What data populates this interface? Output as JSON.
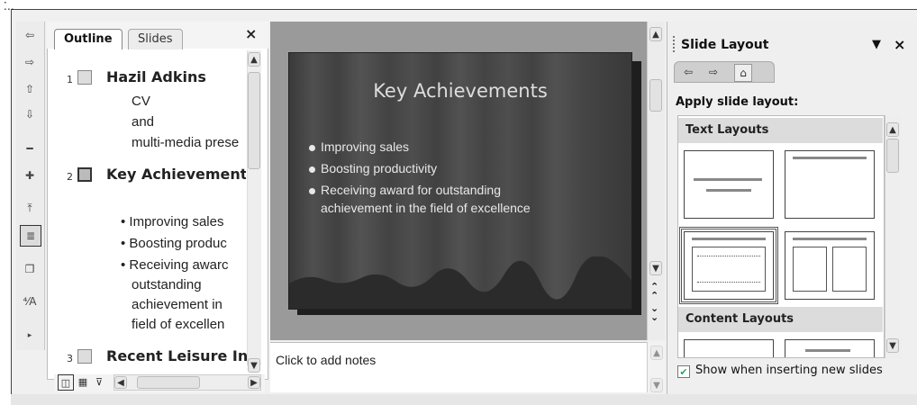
{
  "outline_tabs": {
    "outline": "Outline",
    "slides": "Slides",
    "close": "×"
  },
  "outline": {
    "slides": [
      {
        "num": "1",
        "title": "Hazil Adkins",
        "lines": [
          "CV",
          "and",
          "multi-media prese"
        ]
      },
      {
        "num": "2",
        "title": "Key Achievement",
        "bullets": [
          "• Improving sales",
          "• Boosting produc",
          "• Receiving awarc",
          "outstanding",
          "achievement in",
          "field of excellen"
        ]
      },
      {
        "num": "3",
        "title": "Recent Leisure In"
      }
    ]
  },
  "slide": {
    "title": "Key Achievements",
    "bullets": [
      "Improving sales",
      "Boosting productivity",
      "Receiving award for outstanding",
      "achievement in the field of excellence"
    ]
  },
  "notes": {
    "placeholder": "Click to add notes"
  },
  "taskpane": {
    "title": "Slide Layout",
    "menu_glyph": "▼",
    "close": "×",
    "apply_label": "Apply slide layout:",
    "section_text": "Text Layouts",
    "section_content": "Content Layouts",
    "show_checkbox_label": "Show when inserting new slides",
    "show_checked": true
  },
  "icons": {
    "nav_back": "back-icon",
    "nav_forward": "forward-icon",
    "nav_home": "home-icon"
  }
}
